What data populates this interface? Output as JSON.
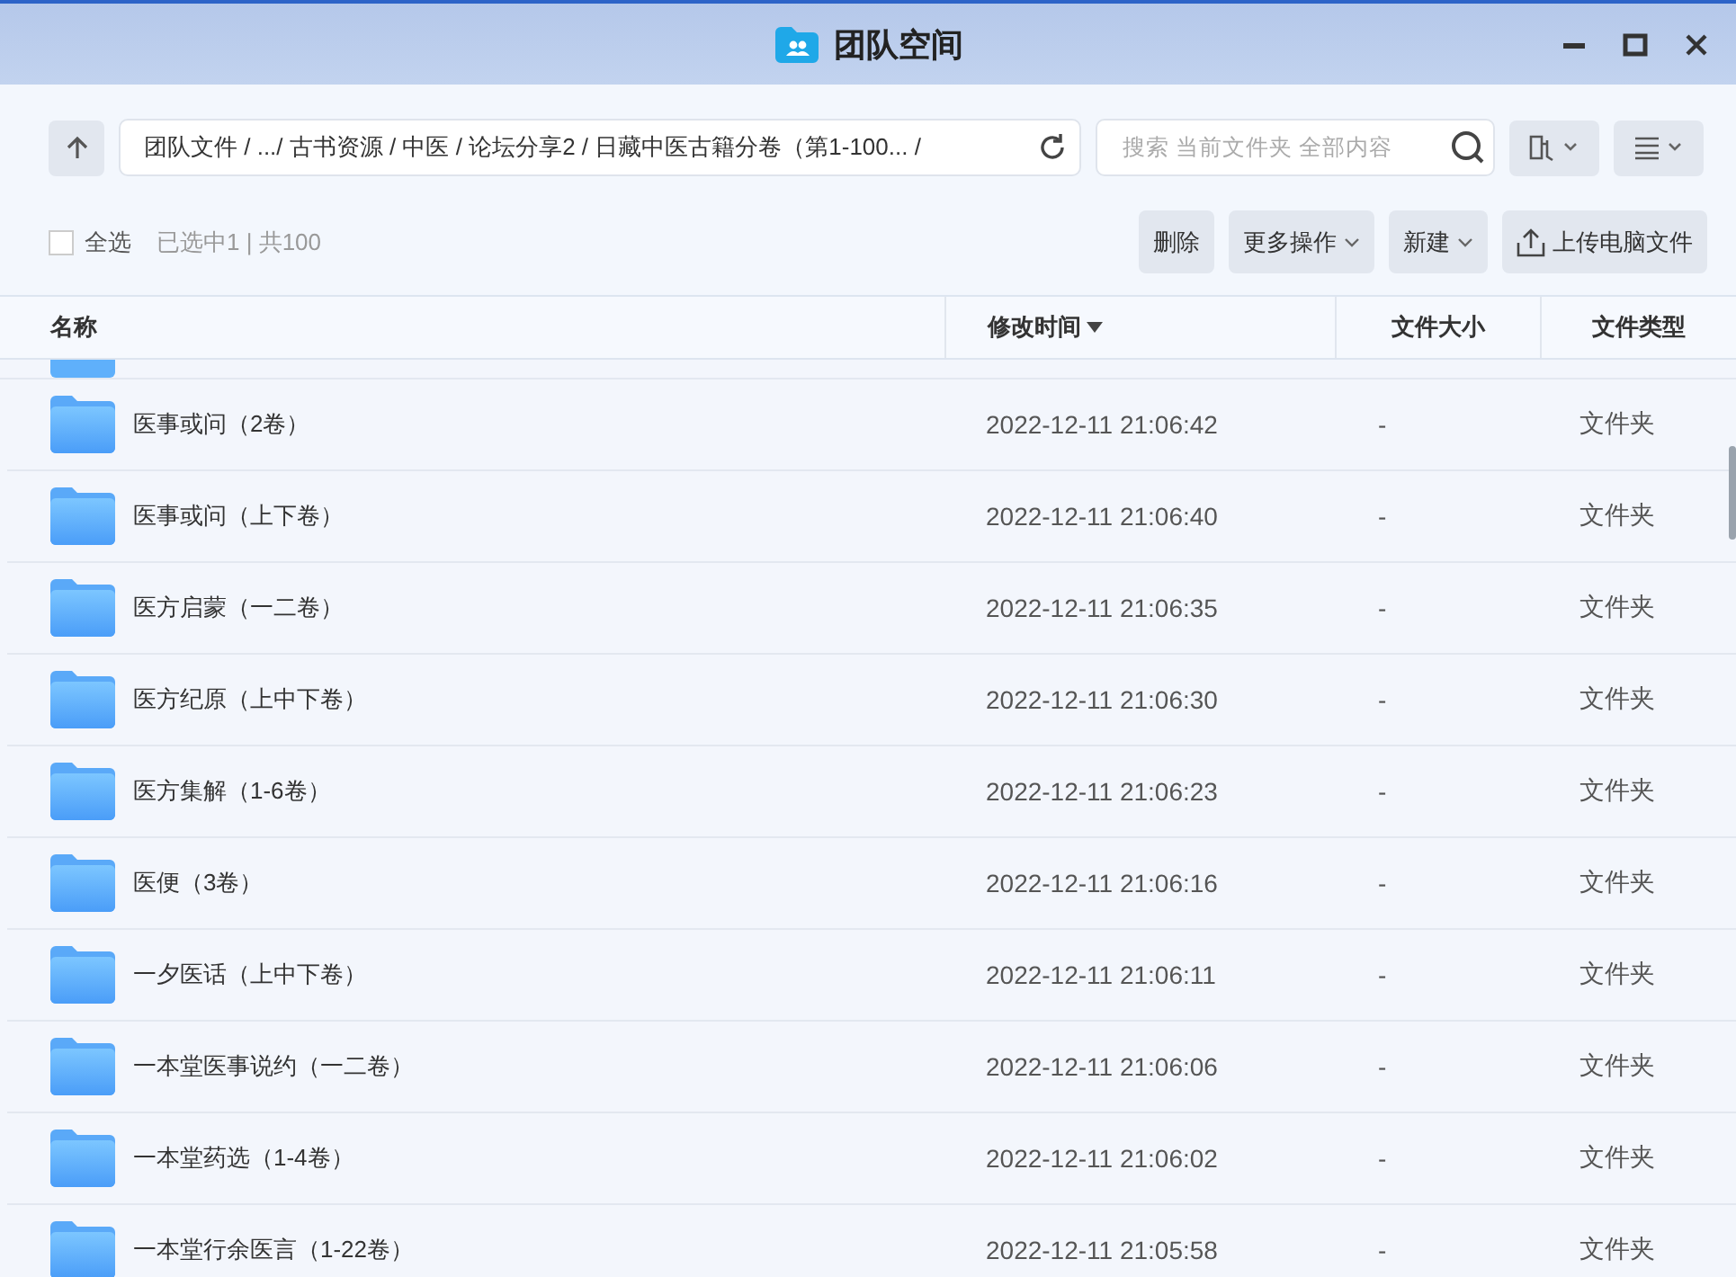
{
  "window": {
    "title": "团队空间"
  },
  "path": "团队文件 / .../ 古书资源 / 中医 / 论坛分享2 / 日藏中医古籍分卷（第1-100... /",
  "search": {
    "placeholder": "搜索 当前文件夹 全部内容"
  },
  "select_all": {
    "label": "全选",
    "checked": false
  },
  "selection_info": "已选中1 | 共100",
  "actions": [
    {
      "label": "删除",
      "kind": "plain"
    },
    {
      "label": "更多操作",
      "kind": "dropdown"
    },
    {
      "label": "新建",
      "kind": "dropdown"
    },
    {
      "label": "上传电脑文件",
      "kind": "upload"
    }
  ],
  "table": {
    "columns": [
      {
        "label": "名称",
        "sorted": false
      },
      {
        "label": "修改时间",
        "sorted": true
      },
      {
        "label": "文件大小",
        "sorted": false
      },
      {
        "label": "文件类型",
        "sorted": false
      }
    ],
    "rows": [
      {
        "name": "医事或问（2卷）",
        "modified": "2022-12-11 21:06:42",
        "size": "-",
        "type": "文件夹"
      },
      {
        "name": "医事或问（上下卷）",
        "modified": "2022-12-11 21:06:40",
        "size": "-",
        "type": "文件夹"
      },
      {
        "name": "医方启蒙（一二卷）",
        "modified": "2022-12-11 21:06:35",
        "size": "-",
        "type": "文件夹"
      },
      {
        "name": "医方纪原（上中下卷）",
        "modified": "2022-12-11 21:06:30",
        "size": "-",
        "type": "文件夹"
      },
      {
        "name": "医方集解（1-6卷）",
        "modified": "2022-12-11 21:06:23",
        "size": "-",
        "type": "文件夹"
      },
      {
        "name": "医便（3卷）",
        "modified": "2022-12-11 21:06:16",
        "size": "-",
        "type": "文件夹"
      },
      {
        "name": "一夕医话（上中下卷）",
        "modified": "2022-12-11 21:06:11",
        "size": "-",
        "type": "文件夹"
      },
      {
        "name": "一本堂医事说约（一二卷）",
        "modified": "2022-12-11 21:06:06",
        "size": "-",
        "type": "文件夹"
      },
      {
        "name": "一本堂药选（1-4卷）",
        "modified": "2022-12-11 21:06:02",
        "size": "-",
        "type": "文件夹"
      },
      {
        "name": "一本堂行余医言（1-22卷）",
        "modified": "2022-12-11 21:05:58",
        "size": "-",
        "type": "文件夹"
      }
    ]
  }
}
